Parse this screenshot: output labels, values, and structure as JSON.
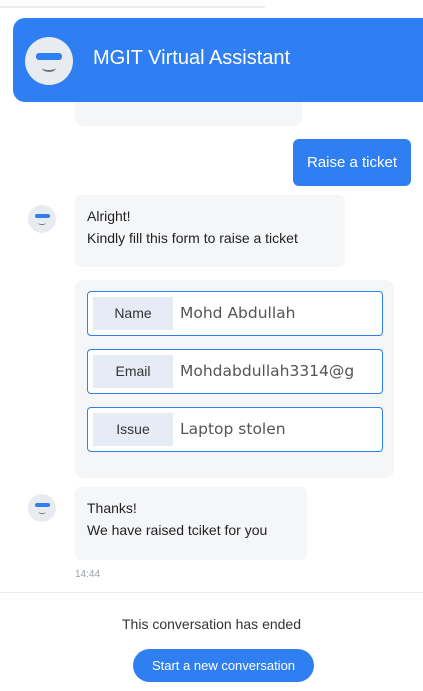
{
  "header": {
    "title": "MGIT Virtual Assistant",
    "avatar_icon": "bot-face-icon",
    "bg_color": "#2f7ff3"
  },
  "messages": {
    "user_message": "Raise a ticket",
    "bot_form_intro": {
      "line1": "Alright!",
      "line2": "Kindly fill this form to raise a ticket"
    },
    "bot_thanks": {
      "line1": "Thanks!",
      "line2": "We have raised tciket for you"
    },
    "timestamp": "14:44"
  },
  "form": {
    "fields": [
      {
        "label": "Name",
        "value": "Mohd Abdullah"
      },
      {
        "label": "Email",
        "value": "Mohdabdullah3314@g"
      },
      {
        "label": "Issue",
        "value": "Laptop stolen"
      }
    ]
  },
  "footer": {
    "ended_text": "This conversation has ended",
    "new_conversation_label": "Start a new conversation"
  },
  "colors": {
    "accent": "#2f7ff3",
    "bot_bubble": "#f5f6f8",
    "label_bg": "#e6ecf5"
  }
}
